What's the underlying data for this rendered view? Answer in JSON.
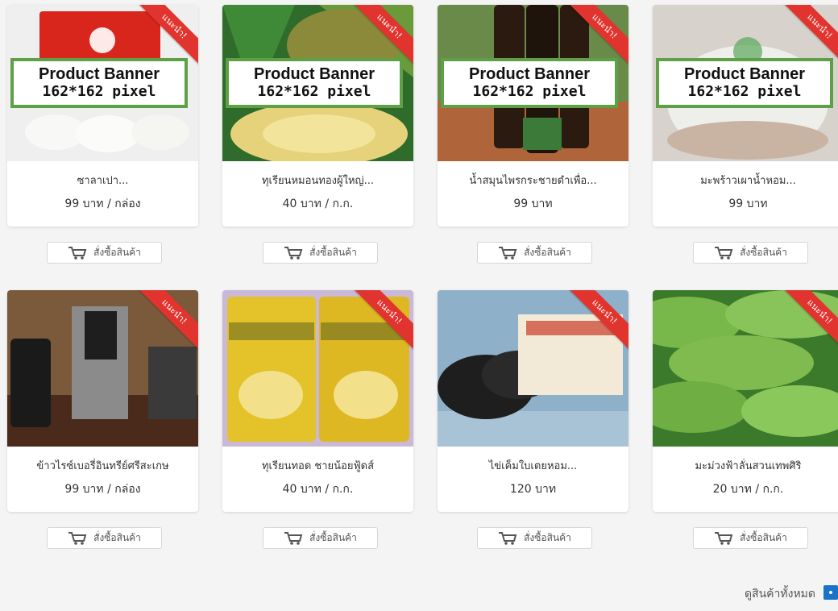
{
  "products": [
    {
      "name": "ซาลาเปา...",
      "price": "99 บาท / กล่อง",
      "ribbon": "แนะนำ!",
      "banner": true
    },
    {
      "name": "ทุเรียนหมอนทองผู้ใหญ่...",
      "price": "40 บาท / ก.ก.",
      "ribbon": "แนะนำ!",
      "banner": true
    },
    {
      "name": "น้ำสมุนไพรกระชายดำเพื่อ...",
      "price": "99 บาท",
      "ribbon": "แนะนำ!",
      "banner": true
    },
    {
      "name": "มะพร้าวเผาน้ำหอม...",
      "price": "99 บาท",
      "ribbon": "แนะนำ!",
      "banner": true
    },
    {
      "name": "ข้าวไรซ์เบอรี่อินทรีย์ศรีสะเกษ",
      "price": "99 บาท / กล่อง",
      "ribbon": "แนะนำ!",
      "banner": false
    },
    {
      "name": "ทุเรียนทอด ชายน้อยฟู้ดส์",
      "price": "40 บาท / ก.ก.",
      "ribbon": "แนะนำ!",
      "banner": false
    },
    {
      "name": "ไข่เค็มใบเตยหอม...",
      "price": "120 บาท",
      "ribbon": "แนะนำ!",
      "banner": false
    },
    {
      "name": "มะม่วงฟ้าลั่นสวนเทพศิริ",
      "price": "20 บาท / ก.ก.",
      "ribbon": "แนะนำ!",
      "banner": false
    }
  ],
  "banner": {
    "line1": "Product Banner",
    "line2": "162*162 pixel"
  },
  "buy_label": "สั่งซื้อสินค้า",
  "view_all": "ดูสินค้าทั้งหมด",
  "colors": {
    "ribbon": "#e1342e",
    "banner_border": "#5ea045",
    "view_all_button": "#1a73c9"
  },
  "icons": {
    "buy": "cart-icon"
  }
}
